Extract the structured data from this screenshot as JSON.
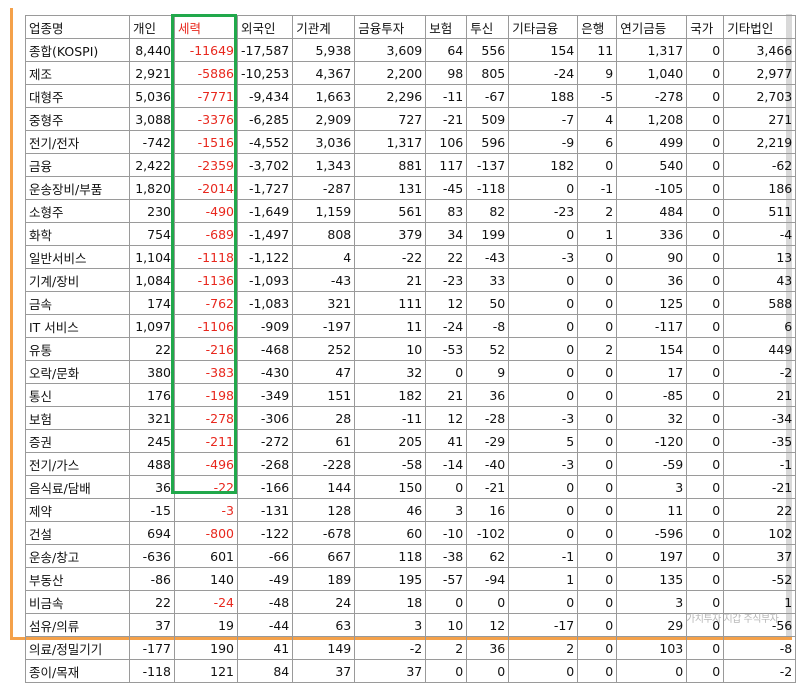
{
  "table": {
    "headers": [
      "업종명",
      "개인",
      "세력",
      "외국인",
      "기관계",
      "금융투자",
      "보험",
      "투신",
      "기타금융",
      "은행",
      "연기금등",
      "국가",
      "기타법인"
    ],
    "rows": [
      [
        "종합(KOSPI)",
        "8,440",
        "-11649",
        "-17,587",
        "5,938",
        "3,609",
        "64",
        "556",
        "154",
        "11",
        "1,317",
        "0",
        "3,466"
      ],
      [
        "제조",
        "2,921",
        "-5886",
        "-10,253",
        "4,367",
        "2,200",
        "98",
        "805",
        "-24",
        "9",
        "1,040",
        "0",
        "2,977"
      ],
      [
        "대형주",
        "5,036",
        "-7771",
        "-9,434",
        "1,663",
        "2,296",
        "-11",
        "-67",
        "188",
        "-5",
        "-278",
        "0",
        "2,703"
      ],
      [
        "중형주",
        "3,088",
        "-3376",
        "-6,285",
        "2,909",
        "727",
        "-21",
        "509",
        "-7",
        "4",
        "1,208",
        "0",
        "271"
      ],
      [
        "전기/전자",
        "-742",
        "-1516",
        "-4,552",
        "3,036",
        "1,317",
        "106",
        "596",
        "-9",
        "6",
        "499",
        "0",
        "2,219"
      ],
      [
        "금융",
        "2,422",
        "-2359",
        "-3,702",
        "1,343",
        "881",
        "117",
        "-137",
        "182",
        "0",
        "540",
        "0",
        "-62"
      ],
      [
        "운송장비/부품",
        "1,820",
        "-2014",
        "-1,727",
        "-287",
        "131",
        "-45",
        "-118",
        "0",
        "-1",
        "-105",
        "0",
        "186"
      ],
      [
        "소형주",
        "230",
        "-490",
        "-1,649",
        "1,159",
        "561",
        "83",
        "82",
        "-23",
        "2",
        "484",
        "0",
        "511"
      ],
      [
        "화학",
        "754",
        "-689",
        "-1,497",
        "808",
        "379",
        "34",
        "199",
        "0",
        "1",
        "336",
        "0",
        "-4"
      ],
      [
        "일반서비스",
        "1,104",
        "-1118",
        "-1,122",
        "4",
        "-22",
        "22",
        "-43",
        "-3",
        "0",
        "90",
        "0",
        "13"
      ],
      [
        "기계/장비",
        "1,084",
        "-1136",
        "-1,093",
        "-43",
        "21",
        "-23",
        "33",
        "0",
        "0",
        "36",
        "0",
        "43"
      ],
      [
        "금속",
        "174",
        "-762",
        "-1,083",
        "321",
        "111",
        "12",
        "50",
        "0",
        "0",
        "125",
        "0",
        "588"
      ],
      [
        "IT 서비스",
        "1,097",
        "-1106",
        "-909",
        "-197",
        "11",
        "-24",
        "-8",
        "0",
        "0",
        "-117",
        "0",
        "6"
      ],
      [
        "유통",
        "22",
        "-216",
        "-468",
        "252",
        "10",
        "-53",
        "52",
        "0",
        "2",
        "154",
        "0",
        "449"
      ],
      [
        "오락/문화",
        "380",
        "-383",
        "-430",
        "47",
        "32",
        "0",
        "9",
        "0",
        "0",
        "17",
        "0",
        "-2"
      ],
      [
        "통신",
        "176",
        "-198",
        "-349",
        "151",
        "182",
        "21",
        "36",
        "0",
        "0",
        "-85",
        "0",
        "21"
      ],
      [
        "보험",
        "321",
        "-278",
        "-306",
        "28",
        "-11",
        "12",
        "-28",
        "-3",
        "0",
        "32",
        "0",
        "-34"
      ],
      [
        "증권",
        "245",
        "-211",
        "-272",
        "61",
        "205",
        "41",
        "-29",
        "5",
        "0",
        "-120",
        "0",
        "-35"
      ],
      [
        "전기/가스",
        "488",
        "-496",
        "-268",
        "-228",
        "-58",
        "-14",
        "-40",
        "-3",
        "0",
        "-59",
        "0",
        "-1"
      ],
      [
        "음식료/담배",
        "36",
        "-22",
        "-166",
        "144",
        "150",
        "0",
        "-21",
        "0",
        "0",
        "3",
        "0",
        "-21"
      ],
      [
        "제약",
        "-15",
        "-3",
        "-131",
        "128",
        "46",
        "3",
        "16",
        "0",
        "0",
        "11",
        "0",
        "22"
      ],
      [
        "건설",
        "694",
        "-800",
        "-122",
        "-678",
        "60",
        "-10",
        "-102",
        "0",
        "0",
        "-596",
        "0",
        "102"
      ],
      [
        "운송/창고",
        "-636",
        "601",
        "-66",
        "667",
        "118",
        "-38",
        "62",
        "-1",
        "0",
        "197",
        "0",
        "37"
      ],
      [
        "부동산",
        "-86",
        "140",
        "-49",
        "189",
        "195",
        "-57",
        "-94",
        "1",
        "0",
        "135",
        "0",
        "-52"
      ],
      [
        "비금속",
        "22",
        "-24",
        "-48",
        "24",
        "18",
        "0",
        "0",
        "0",
        "0",
        "3",
        "0",
        "1"
      ],
      [
        "섬유/의류",
        "37",
        "19",
        "-44",
        "63",
        "3",
        "10",
        "12",
        "-17",
        "0",
        "29",
        "0",
        "-56"
      ],
      [
        "의료/정밀기기",
        "-177",
        "190",
        "41",
        "149",
        "-2",
        "2",
        "36",
        "2",
        "0",
        "103",
        "0",
        "-8"
      ],
      [
        "종이/목재",
        "-118",
        "121",
        "84",
        "37",
        "37",
        "0",
        "0",
        "0",
        "0",
        "0",
        "0",
        "-2"
      ]
    ]
  },
  "highlight_color": "#21a84b",
  "negative_color": "#e8281e",
  "watermark": "가치투자 지갑 주식부자"
}
